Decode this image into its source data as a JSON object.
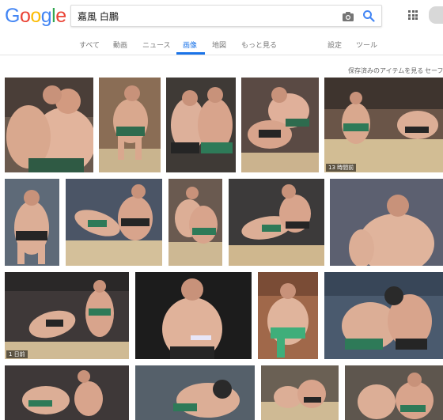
{
  "search": {
    "query": "嘉風 白鵬"
  },
  "tabs": [
    {
      "label": "すべて"
    },
    {
      "label": "動画"
    },
    {
      "label": "ニュース"
    },
    {
      "label": "画像"
    },
    {
      "label": "地図"
    },
    {
      "label": "もっと見る"
    },
    {
      "label": "設定"
    },
    {
      "label": "ツール"
    }
  ],
  "active_tab": "画像",
  "tools_line": {
    "saved_items": "保存済みのアイテムを見る",
    "safesearch": "セーフ"
  },
  "image_captions": {
    "row1_img5": "13 時間前",
    "row3_img1": "1 日前"
  },
  "colors": {
    "google_blue": "#4285F4",
    "google_red": "#EA4335",
    "google_yellow": "#FBBC05",
    "google_green": "#34A853",
    "active_tab": "#1a73e8"
  },
  "icons": [
    "camera-icon",
    "search-icon",
    "apps-icon"
  ]
}
